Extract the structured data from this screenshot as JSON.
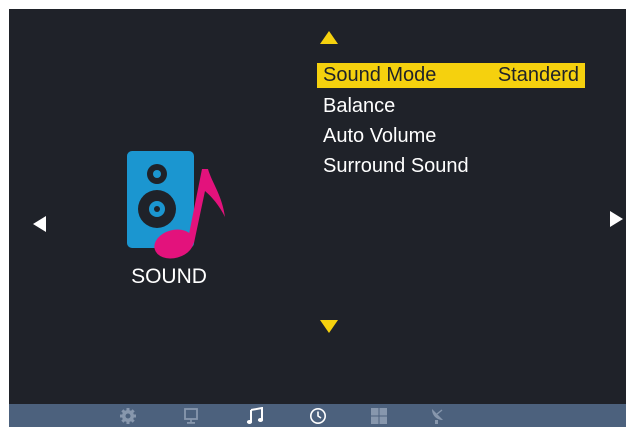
{
  "menu": {
    "items": [
      {
        "label": "Sound Mode",
        "value": "Standerd",
        "selected": true
      },
      {
        "label": "Balance",
        "value": ""
      },
      {
        "label": "Auto Volume",
        "value": ""
      },
      {
        "label": "Surround Sound",
        "value": ""
      }
    ]
  },
  "category": {
    "label": "SOUND",
    "icon": "speaker-music-note-icon"
  },
  "tabs": [
    {
      "name": "settings",
      "icon": "gear-icon"
    },
    {
      "name": "picture",
      "icon": "monitor-icon"
    },
    {
      "name": "sound",
      "icon": "music-note-icon",
      "active": true
    },
    {
      "name": "time",
      "icon": "clock-icon"
    },
    {
      "name": "apps",
      "icon": "grid-icon"
    },
    {
      "name": "channel",
      "icon": "satellite-dish-icon"
    }
  ],
  "colors": {
    "background": "#1f2229",
    "highlight": "#f5d10e",
    "bottom_bar": "#4c617d",
    "speaker": "#1b96d0",
    "note": "#e3127c"
  }
}
